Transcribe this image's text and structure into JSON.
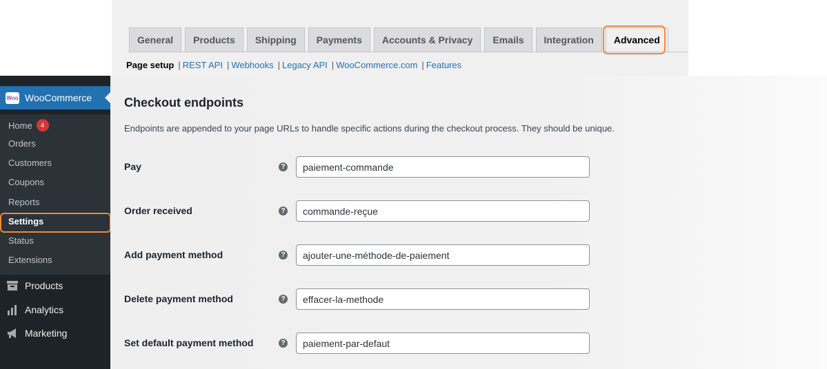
{
  "tabs": [
    {
      "label": "General"
    },
    {
      "label": "Products"
    },
    {
      "label": "Shipping"
    },
    {
      "label": "Payments"
    },
    {
      "label": "Accounts & Privacy"
    },
    {
      "label": "Emails"
    },
    {
      "label": "Integration"
    },
    {
      "label": "Advanced",
      "active": true
    }
  ],
  "subnav": {
    "current": "Page setup",
    "links": [
      "REST API",
      "Webhooks",
      "Legacy API",
      "WooCommerce.com",
      "Features"
    ]
  },
  "sidebar": {
    "woocommerce": "WooCommerce",
    "logo_text": "Woo",
    "submenu": [
      {
        "label": "Home",
        "badge": "4"
      },
      {
        "label": "Orders"
      },
      {
        "label": "Customers"
      },
      {
        "label": "Coupons"
      },
      {
        "label": "Reports"
      },
      {
        "label": "Settings",
        "current": true
      },
      {
        "label": "Status"
      },
      {
        "label": "Extensions"
      }
    ],
    "menu": [
      {
        "label": "Products",
        "icon": "archive-icon"
      },
      {
        "label": "Analytics",
        "icon": "bar-chart-icon"
      },
      {
        "label": "Marketing",
        "icon": "megaphone-icon"
      }
    ]
  },
  "section": {
    "title": "Checkout endpoints",
    "description": "Endpoints are appended to your page URLs to handle specific actions during the checkout process. They should be unique."
  },
  "fields": [
    {
      "label": "Pay",
      "value": "paiement-commande"
    },
    {
      "label": "Order received",
      "value": "commande-reçue"
    },
    {
      "label": "Add payment method",
      "value": "ajouter-une-méthode-de-paiement"
    },
    {
      "label": "Delete payment method",
      "value": "effacer-la-methode"
    },
    {
      "label": "Set default payment method",
      "value": "paiement-par-defaut"
    }
  ],
  "help_glyph": "?",
  "colors": {
    "accent": "#2271b1",
    "highlight": "#f0883a",
    "sidebar": "#1d2327",
    "badge": "#d63638"
  }
}
